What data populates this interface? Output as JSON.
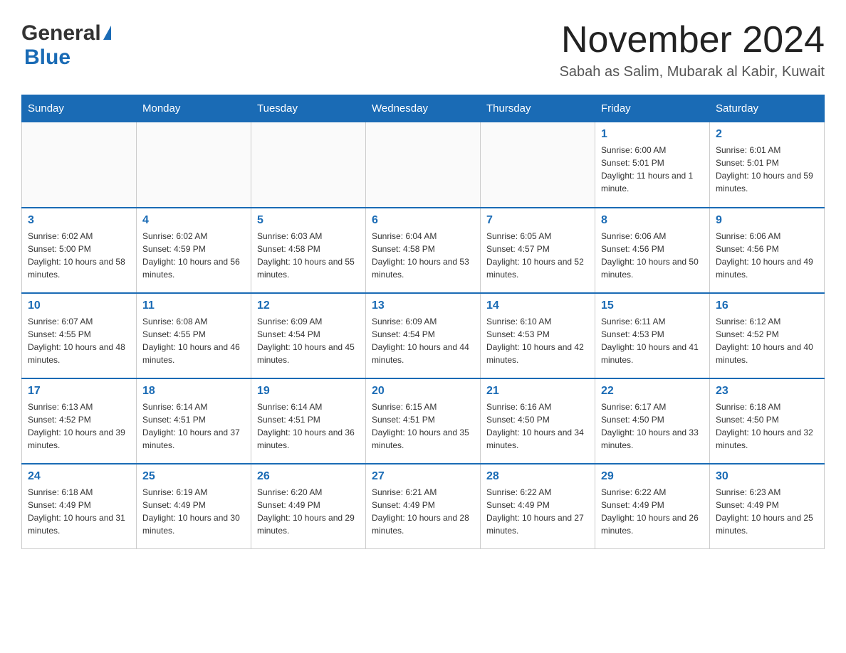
{
  "header": {
    "logo_general": "General",
    "logo_blue": "Blue",
    "month_year": "November 2024",
    "location": "Sabah as Salim, Mubarak al Kabir, Kuwait"
  },
  "days_of_week": [
    "Sunday",
    "Monday",
    "Tuesday",
    "Wednesday",
    "Thursday",
    "Friday",
    "Saturday"
  ],
  "weeks": [
    [
      {
        "day": "",
        "info": ""
      },
      {
        "day": "",
        "info": ""
      },
      {
        "day": "",
        "info": ""
      },
      {
        "day": "",
        "info": ""
      },
      {
        "day": "",
        "info": ""
      },
      {
        "day": "1",
        "info": "Sunrise: 6:00 AM\nSunset: 5:01 PM\nDaylight: 11 hours and 1 minute."
      },
      {
        "day": "2",
        "info": "Sunrise: 6:01 AM\nSunset: 5:01 PM\nDaylight: 10 hours and 59 minutes."
      }
    ],
    [
      {
        "day": "3",
        "info": "Sunrise: 6:02 AM\nSunset: 5:00 PM\nDaylight: 10 hours and 58 minutes."
      },
      {
        "day": "4",
        "info": "Sunrise: 6:02 AM\nSunset: 4:59 PM\nDaylight: 10 hours and 56 minutes."
      },
      {
        "day": "5",
        "info": "Sunrise: 6:03 AM\nSunset: 4:58 PM\nDaylight: 10 hours and 55 minutes."
      },
      {
        "day": "6",
        "info": "Sunrise: 6:04 AM\nSunset: 4:58 PM\nDaylight: 10 hours and 53 minutes."
      },
      {
        "day": "7",
        "info": "Sunrise: 6:05 AM\nSunset: 4:57 PM\nDaylight: 10 hours and 52 minutes."
      },
      {
        "day": "8",
        "info": "Sunrise: 6:06 AM\nSunset: 4:56 PM\nDaylight: 10 hours and 50 minutes."
      },
      {
        "day": "9",
        "info": "Sunrise: 6:06 AM\nSunset: 4:56 PM\nDaylight: 10 hours and 49 minutes."
      }
    ],
    [
      {
        "day": "10",
        "info": "Sunrise: 6:07 AM\nSunset: 4:55 PM\nDaylight: 10 hours and 48 minutes."
      },
      {
        "day": "11",
        "info": "Sunrise: 6:08 AM\nSunset: 4:55 PM\nDaylight: 10 hours and 46 minutes."
      },
      {
        "day": "12",
        "info": "Sunrise: 6:09 AM\nSunset: 4:54 PM\nDaylight: 10 hours and 45 minutes."
      },
      {
        "day": "13",
        "info": "Sunrise: 6:09 AM\nSunset: 4:54 PM\nDaylight: 10 hours and 44 minutes."
      },
      {
        "day": "14",
        "info": "Sunrise: 6:10 AM\nSunset: 4:53 PM\nDaylight: 10 hours and 42 minutes."
      },
      {
        "day": "15",
        "info": "Sunrise: 6:11 AM\nSunset: 4:53 PM\nDaylight: 10 hours and 41 minutes."
      },
      {
        "day": "16",
        "info": "Sunrise: 6:12 AM\nSunset: 4:52 PM\nDaylight: 10 hours and 40 minutes."
      }
    ],
    [
      {
        "day": "17",
        "info": "Sunrise: 6:13 AM\nSunset: 4:52 PM\nDaylight: 10 hours and 39 minutes."
      },
      {
        "day": "18",
        "info": "Sunrise: 6:14 AM\nSunset: 4:51 PM\nDaylight: 10 hours and 37 minutes."
      },
      {
        "day": "19",
        "info": "Sunrise: 6:14 AM\nSunset: 4:51 PM\nDaylight: 10 hours and 36 minutes."
      },
      {
        "day": "20",
        "info": "Sunrise: 6:15 AM\nSunset: 4:51 PM\nDaylight: 10 hours and 35 minutes."
      },
      {
        "day": "21",
        "info": "Sunrise: 6:16 AM\nSunset: 4:50 PM\nDaylight: 10 hours and 34 minutes."
      },
      {
        "day": "22",
        "info": "Sunrise: 6:17 AM\nSunset: 4:50 PM\nDaylight: 10 hours and 33 minutes."
      },
      {
        "day": "23",
        "info": "Sunrise: 6:18 AM\nSunset: 4:50 PM\nDaylight: 10 hours and 32 minutes."
      }
    ],
    [
      {
        "day": "24",
        "info": "Sunrise: 6:18 AM\nSunset: 4:49 PM\nDaylight: 10 hours and 31 minutes."
      },
      {
        "day": "25",
        "info": "Sunrise: 6:19 AM\nSunset: 4:49 PM\nDaylight: 10 hours and 30 minutes."
      },
      {
        "day": "26",
        "info": "Sunrise: 6:20 AM\nSunset: 4:49 PM\nDaylight: 10 hours and 29 minutes."
      },
      {
        "day": "27",
        "info": "Sunrise: 6:21 AM\nSunset: 4:49 PM\nDaylight: 10 hours and 28 minutes."
      },
      {
        "day": "28",
        "info": "Sunrise: 6:22 AM\nSunset: 4:49 PM\nDaylight: 10 hours and 27 minutes."
      },
      {
        "day": "29",
        "info": "Sunrise: 6:22 AM\nSunset: 4:49 PM\nDaylight: 10 hours and 26 minutes."
      },
      {
        "day": "30",
        "info": "Sunrise: 6:23 AM\nSunset: 4:49 PM\nDaylight: 10 hours and 25 minutes."
      }
    ]
  ]
}
